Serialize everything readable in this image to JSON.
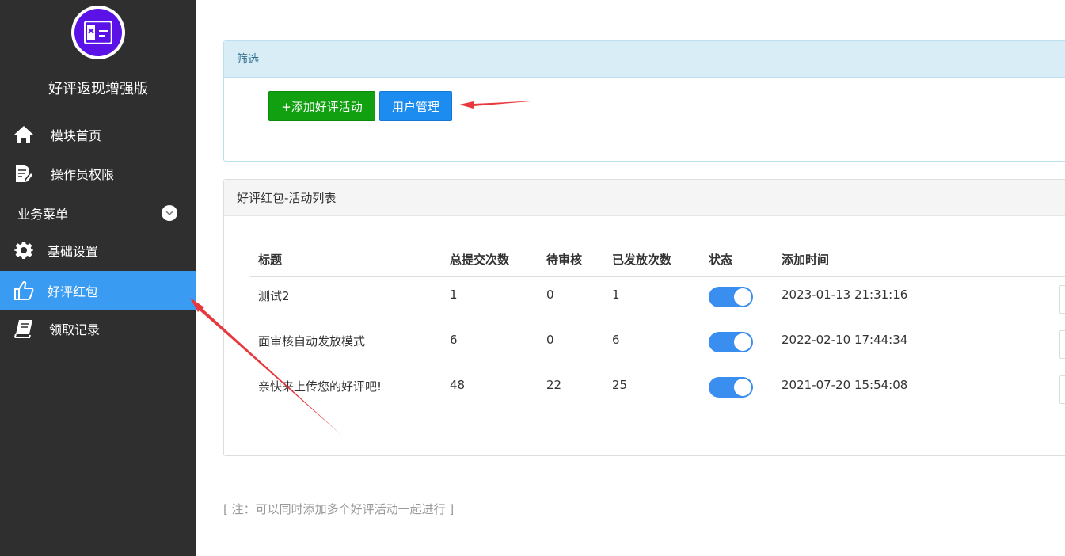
{
  "sidebar": {
    "app_title": "好评返现增强版",
    "items": [
      {
        "label": "模块首页",
        "icon": "home-icon"
      },
      {
        "label": "操作员权限",
        "icon": "edit-doc-icon"
      }
    ],
    "group": {
      "label": "业务菜单",
      "icon": "chevron-down-icon"
    },
    "sub_items": [
      {
        "label": "基础设置",
        "icon": "gear-icon"
      },
      {
        "label": "好评红包",
        "icon": "thumbs-up-icon",
        "active": true
      },
      {
        "label": "领取记录",
        "icon": "book-icon"
      }
    ],
    "active_color": "#3a9bf3",
    "bg_color": "#2f2f2f"
  },
  "filter": {
    "title": "筛选",
    "add_button": "+添加好评活动",
    "user_button": "用户管理"
  },
  "list": {
    "title": "好评红包-活动列表",
    "columns": [
      "标题",
      "总提交次数",
      "待审核",
      "已发放次数",
      "状态",
      "添加时间"
    ],
    "rows": [
      {
        "title": "测试2",
        "total": "1",
        "pending": "0",
        "issued": "1",
        "status_on": true,
        "added": "2023-01-13 21:31:16"
      },
      {
        "title": "面审核自动发放模式",
        "total": "6",
        "pending": "0",
        "issued": "6",
        "status_on": true,
        "added": "2022-02-10 17:44:34"
      },
      {
        "title": "亲快来上传您的好评吧!",
        "total": "48",
        "pending": "22",
        "issued": "25",
        "status_on": true,
        "added": "2021-07-20 15:54:08"
      }
    ]
  },
  "note": "[ 注：可以同时添加多个好评活动一起进行 ]",
  "colors": {
    "add_button": "#10a010",
    "user_button": "#1d8cf0",
    "toggle_on": "#3a8ef0",
    "annotation_arrow": "#e8383d"
  }
}
